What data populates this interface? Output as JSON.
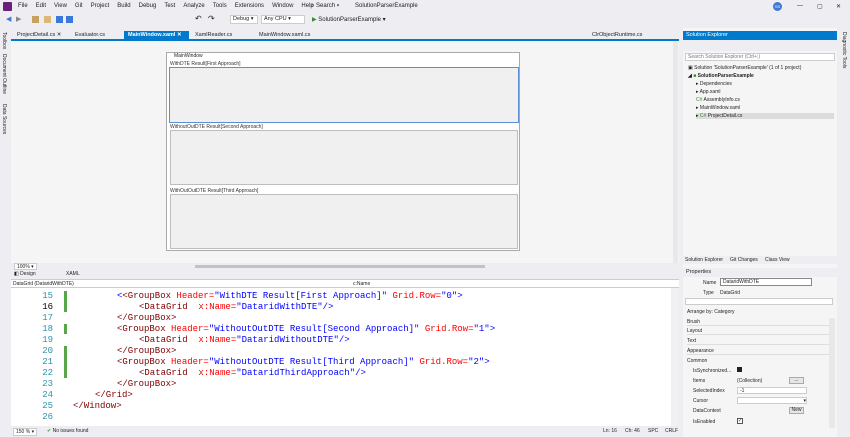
{
  "menu": [
    "File",
    "Edit",
    "View",
    "Git",
    "Project",
    "Build",
    "Debug",
    "Test",
    "Analyze",
    "Tools",
    "Extensions",
    "Window",
    "Help"
  ],
  "search_label": "Search",
  "solution_name": "SolutionParserExample",
  "user_initials": "SS",
  "toolbar": {
    "config": "Debug",
    "platform": "Any CPU",
    "run_target": "SolutionParserExample"
  },
  "left_tabs": [
    "Toolbox",
    "Document Outline",
    "Data Sources"
  ],
  "right_tabs": [
    "Diagnostic Tools"
  ],
  "doc_tabs": [
    "ProjectDetail.cs",
    "Evaluator.cs",
    "MainWindow.xaml",
    "XamlReader.cs",
    "MainWindow.xaml.cs",
    "ClrObjectRuntime.cs"
  ],
  "designer": {
    "window_title": "MainWindow",
    "groups": [
      "WithDTE Result[First Approach]",
      "WithoutOutDTE Result[Second Approach]",
      "WithOutOutDTE Result[Third Approach]"
    ]
  },
  "zoom": "100%",
  "view_design": "Design",
  "view_xaml": "XAML",
  "nav_left": "DataGrid (DataridWithDTE)",
  "nav_right": "c:Name",
  "code": {
    "line_numbers": [
      "15",
      "16",
      "17",
      "18",
      "19",
      "20",
      "21",
      "22",
      "23",
      "24",
      "25",
      "26"
    ],
    "l15a": "<GroupBox ",
    "l15b": "Header=",
    "l15c": "\"WithDTE Result[First Approach]\"",
    "l15d": " Grid.Row=",
    "l15e": "\"0\"",
    "l15f": ">",
    "l16a": "<DataGrid ",
    "l16b": " x:Name=",
    "l16c": "\"DataridWithDTE\"",
    "l16d": "/>",
    "l17": "</GroupBox>",
    "l18a": "<GroupBox ",
    "l18b": "Header=",
    "l18c": "\"WithoutOutDTE Result[Second Approach]\"",
    "l18d": " Grid.Row=",
    "l18e": "\"1\"",
    "l18f": ">",
    "l19a": "<DataGrid ",
    "l19b": " x:Name=",
    "l19c": "\"DataridWithoutDTE\"",
    "l19d": "/>",
    "l20": "</GroupBox>",
    "l21a": "<GroupBox ",
    "l21b": "Header=",
    "l21c": "\"WithoutOutDTE Result[Third Approach]\"",
    "l21d": " Grid.Row=",
    "l21e": "\"2\"",
    "l21f": ">",
    "l22a": "<DataGrid ",
    "l22b": " x:Name=",
    "l22c": "\"DataridThirdApproach\"",
    "l22d": "/>",
    "l23": "</GroupBox>",
    "l24": "</Grid>",
    "l25": "</Window>"
  },
  "status": {
    "zoom": "150 %",
    "issues": "No issues found",
    "ln": "Ln: 16",
    "ch": "Ch: 46",
    "spc": "SPC",
    "crlf": "CRLF"
  },
  "solution_explorer": {
    "title": "Solution Explorer",
    "search_placeholder": "Search Solution Explorer (Ctrl+;)",
    "items": [
      "Solution 'SolutionParserExample' (1 of 1 project)",
      "SolutionParserExample",
      "Dependencies",
      "App.xaml",
      "AssemblyInfo.cs",
      "MainWindow.xaml",
      "ProjectDetail.cs"
    ],
    "bottom_tabs": [
      "Solution Explorer",
      "Git Changes",
      "Class View"
    ]
  },
  "properties": {
    "title": "Properties",
    "name_label": "Name",
    "name_value": "DataridWithDTE",
    "type_label": "Type",
    "type_value": "DataGrid",
    "arrange": "Arrange by: Category",
    "categories": [
      "Brush",
      "Layout",
      "Text",
      "Appearance",
      "Common"
    ],
    "rows": [
      {
        "k": "IsSynchronized...",
        "v": ""
      },
      {
        "k": "Items",
        "v": "(Collection)"
      },
      {
        "k": "SelectedIndex",
        "v": "-1"
      },
      {
        "k": "Cursor",
        "v": ""
      },
      {
        "k": "DataContext",
        "v": "New"
      },
      {
        "k": "IsEnabled",
        "v": ""
      }
    ]
  }
}
